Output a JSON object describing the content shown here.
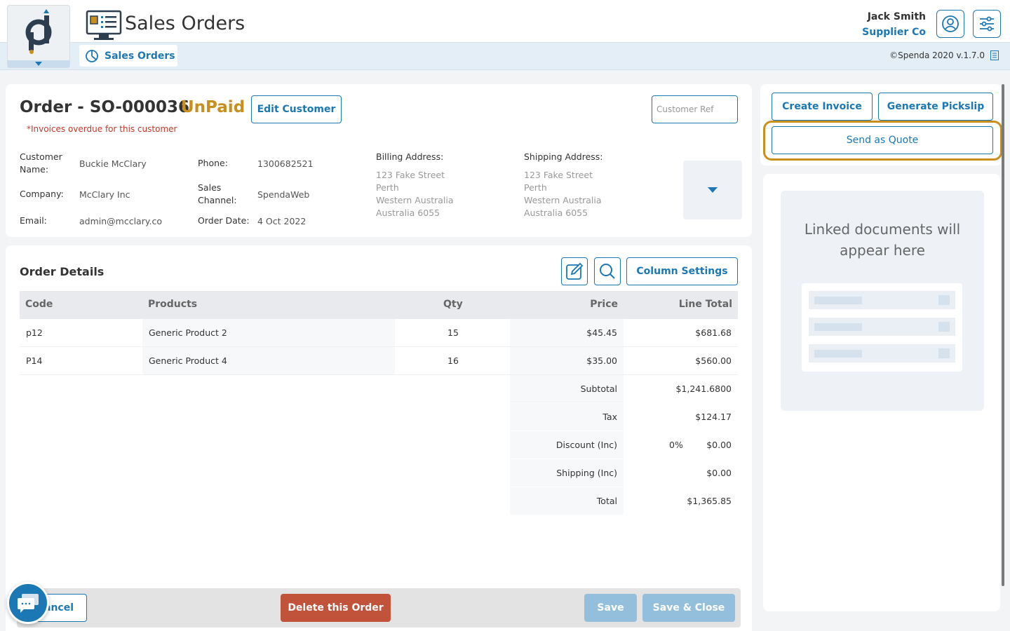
{
  "header": {
    "app_title": "Sales Orders",
    "tab_label": "Sales Orders",
    "user_name": "Jack Smith",
    "user_company": "Supplier Co",
    "version": "©Spenda 2020 v.1.7.0"
  },
  "order": {
    "title": "Order - SO-000036",
    "status": "UnPaid",
    "edit_customer_label": "Edit Customer",
    "warning": "*Invoices overdue for this customer",
    "customer_ref_placeholder": "Customer Ref",
    "fields": {
      "customer_name_label": "Customer Name:",
      "customer_name": "Buckie McClary",
      "company_label": "Company:",
      "company": "McClary Inc",
      "email_label": "Email:",
      "email": "admin@mcclary.co",
      "phone_label": "Phone:",
      "phone": "1300682521",
      "sales_channel_label": "Sales Channel:",
      "sales_channel": "SpendaWeb",
      "order_date_label": "Order Date:",
      "order_date": "4 Oct 2022"
    },
    "billing": {
      "label": "Billing Address:",
      "line1": "123 Fake Street",
      "line2": "Perth",
      "line3": "Western Australia",
      "line4": "Australia 6055"
    },
    "shipping": {
      "label": "Shipping Address:",
      "line1": "123 Fake Street",
      "line2": "Perth",
      "line3": "Western Australia",
      "line4": "Australia 6055"
    }
  },
  "details": {
    "title": "Order Details",
    "column_settings_label": "Column Settings",
    "columns": {
      "code": "Code",
      "products": "Products",
      "qty": "Qty",
      "price": "Price",
      "line_total": "Line Total"
    },
    "rows": [
      {
        "code": "p12",
        "product": "Generic Product 2",
        "qty": "15",
        "price": "$45.45",
        "line_total": "$681.68"
      },
      {
        "code": "P14",
        "product": "Generic Product 4",
        "qty": "16",
        "price": "$35.00",
        "line_total": "$560.00"
      }
    ],
    "summary": {
      "subtotal_label": "Subtotal",
      "subtotal": "$1,241.6800",
      "tax_label": "Tax",
      "tax": "$124.17",
      "discount_label": "Discount (Inc)",
      "discount_pct": "0%",
      "discount": "$0.00",
      "shipping_label": "Shipping (Inc)",
      "shipping": "$0.00",
      "total_label": "Total",
      "total": "$1,365.85"
    }
  },
  "footer": {
    "cancel_label": "Cancel",
    "delete_label": "Delete this Order",
    "save_label": "Save",
    "save_close_label": "Save & Close"
  },
  "sidepanel": {
    "create_invoice_label": "Create Invoice",
    "generate_pickslip_label": "Generate Pickslip",
    "send_quote_label": "Send as Quote",
    "linked_docs_text": "Linked documents will appear here"
  },
  "colors": {
    "primary": "#1c78b4",
    "status": "#c88f1d",
    "danger": "#c0533a",
    "disabled": "#93bfdc"
  }
}
